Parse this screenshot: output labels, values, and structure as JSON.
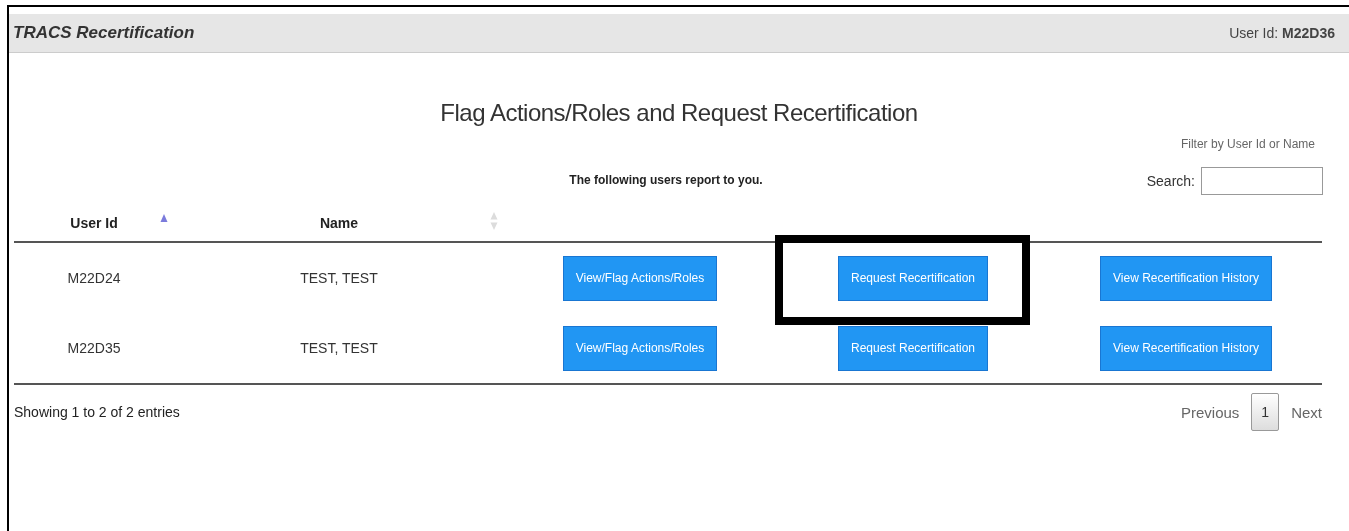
{
  "header": {
    "app_title": "TRACS Recertification",
    "user_label": "User Id:",
    "user_id": "M22D36"
  },
  "title": "Flag Actions/Roles and Request Recertification",
  "filter_hint": "Filter by User Id or Name",
  "subtitle": "The following users report to you.",
  "search": {
    "label": "Search:"
  },
  "columns": [
    {
      "label": "User Id",
      "sorted": true
    },
    {
      "label": "Name",
      "sorted": false
    }
  ],
  "rows": [
    {
      "user_id": "M22D24",
      "name": "TEST, TEST",
      "actions": [
        {
          "label": "View/Flag Actions/Roles",
          "highlighted": false
        },
        {
          "label": "Request Recertification",
          "highlighted": true
        },
        {
          "label": "View Recertification History",
          "highlighted": false
        }
      ]
    },
    {
      "user_id": "M22D35",
      "name": "TEST, TEST",
      "actions": [
        {
          "label": "View/Flag Actions/Roles",
          "highlighted": false
        },
        {
          "label": "Request Recertification",
          "highlighted": false
        },
        {
          "label": "View Recertification History",
          "highlighted": false
        }
      ]
    }
  ],
  "info": "Showing 1 to 2 of 2 entries",
  "pagination": {
    "previous": "Previous",
    "pages": [
      {
        "label": "1",
        "selected": true
      }
    ],
    "next": "Next"
  }
}
